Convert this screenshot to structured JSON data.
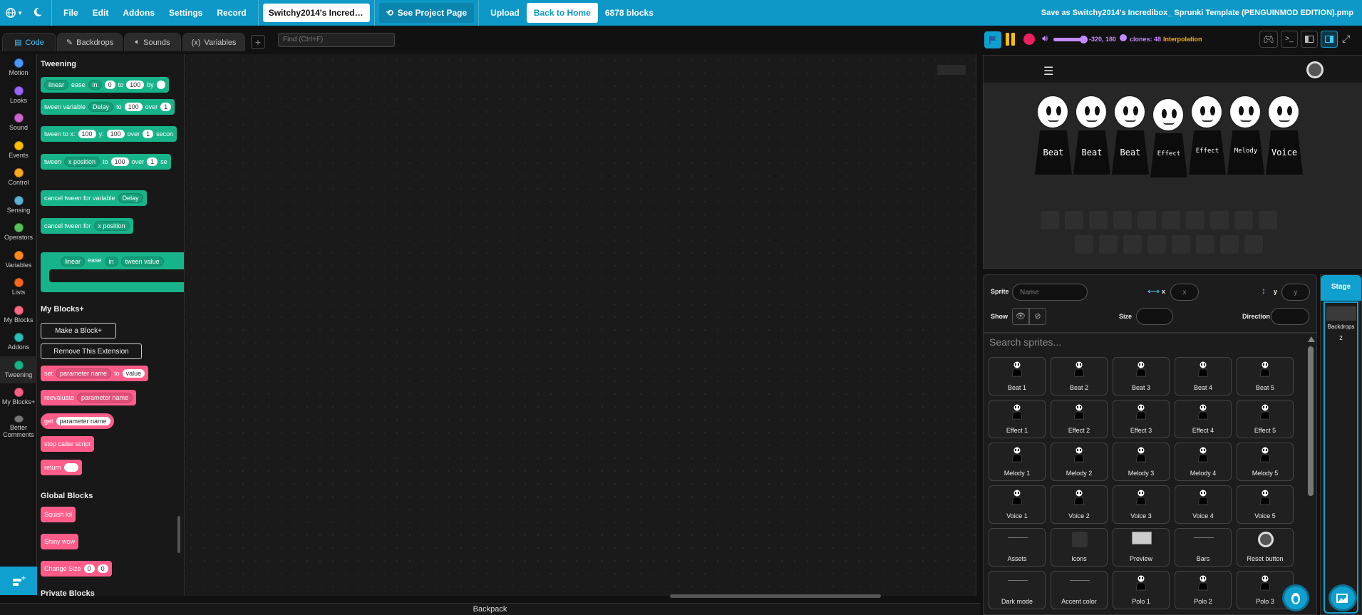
{
  "menubar": {
    "file": "File",
    "edit": "Edit",
    "addons": "Addons",
    "settings": "Settings",
    "record": "Record",
    "project_title": "Switchy2014's Incredibox...",
    "see_project": "See Project Page",
    "upload": "Upload",
    "back_home": "Back to Home",
    "block_count": "6878 blocks",
    "save_as": "Save as  Switchy2014's Incredibox_ Sprunki Template (PENGUINMOD EDITION).pmp"
  },
  "tabs": {
    "code": "Code",
    "backdrops": "Backdrops",
    "sounds": "Sounds",
    "variables": "Variables"
  },
  "find_placeholder": "Find (Ctrl+F)",
  "categories": [
    {
      "label": "Motion",
      "color": "#4c97ff"
    },
    {
      "label": "Looks",
      "color": "#9966ff"
    },
    {
      "label": "Sound",
      "color": "#cf63cf"
    },
    {
      "label": "Events",
      "color": "#ffbf00"
    },
    {
      "label": "Control",
      "color": "#ffab19"
    },
    {
      "label": "Sensing",
      "color": "#5cb1d6"
    },
    {
      "label": "Operators",
      "color": "#59c059"
    },
    {
      "label": "Variables",
      "color": "#ff8c1a"
    },
    {
      "label": "Lists",
      "color": "#ff661a"
    },
    {
      "label": "My Blocks",
      "color": "#ff6680"
    },
    {
      "label": "Addons",
      "color": "#29beb8"
    },
    {
      "label": "Tweening",
      "color": "#17b48a"
    },
    {
      "label": "My Blocks+",
      "color": "#ff5c8a"
    },
    {
      "label": "Better Comments",
      "color": "#777777"
    }
  ],
  "flyout": {
    "tweening_title": "Tweening",
    "b1": {
      "a": "linear",
      "b": "ease",
      "c": "in",
      "d": "0",
      "e": "to",
      "f": "100",
      "g": "by"
    },
    "b2": {
      "a": "tween variable",
      "b": "Delay",
      "c": "to",
      "d": "100",
      "e": "over",
      "f": "1"
    },
    "b3": {
      "a": "tween to x:",
      "b": "100",
      "c": "y:",
      "d": "100",
      "e": "over",
      "f": "1",
      "g": "secon"
    },
    "b4": {
      "a": "tween",
      "b": "x position",
      "c": "to",
      "d": "100",
      "e": "over",
      "f": "1",
      "g": "se"
    },
    "b5": {
      "a": "cancel tween for variable",
      "b": "Delay"
    },
    "b6": {
      "a": "cancel tween for",
      "b": "x position"
    },
    "b7": {
      "a": "linear",
      "b": "ease",
      "c": "in",
      "d": "tween value"
    },
    "myblocks_title": "My Blocks+",
    "make_block": "Make a Block+",
    "remove_ext": "Remove This Extension",
    "b8": {
      "a": "set",
      "b": "parameter name",
      "c": "to",
      "d": "value"
    },
    "b9": {
      "a": "reevaluate",
      "b": "parameter name"
    },
    "b10": {
      "a": "get",
      "b": "parameter name"
    },
    "b11": "stop caller script",
    "b12": "return",
    "global_title": "Global Blocks",
    "g1": "Squish lol",
    "g2": "Shiny wow",
    "g3": {
      "a": "Change Size",
      "b": "0",
      "c": "0"
    },
    "private_title": "Private Blocks"
  },
  "backpack": "Backpack",
  "stagebar": {
    "coords": "-320, 180",
    "clones": "clones: 48",
    "interpolation": "Interpolation"
  },
  "stage": {
    "characters": [
      "Beat",
      "Beat",
      "Beat",
      "Effect",
      "Effect",
      "Melody",
      "Voice"
    ]
  },
  "sprite_info": {
    "sprite": "Sprite",
    "name_placeholder": "Name",
    "x": "x",
    "y": "y",
    "x_placeholder": "x",
    "y_placeholder": "y",
    "show": "Show",
    "size": "Size",
    "direction": "Direction"
  },
  "search_placeholder": "Search sprites...",
  "sprites": [
    "Beat 1",
    "Beat 2",
    "Beat 3",
    "Beat 4",
    "Beat 5",
    "Effect 1",
    "Effect 2",
    "Effect 3",
    "Effect 4",
    "Effect 5",
    "Melody 1",
    "Melody 2",
    "Melody 3",
    "Melody 4",
    "Melody 5",
    "Voice 1",
    "Voice 2",
    "Voice 3",
    "Voice 4",
    "Voice 5",
    "Assets",
    "Icons",
    "Preview",
    "Bars",
    "Reset button",
    "Dark mode",
    "Accent color",
    "Polo 1",
    "Polo 2",
    "Polo 3"
  ],
  "stage_panel": {
    "stage": "Stage",
    "backdrops": "Backdrops",
    "count": "2"
  }
}
